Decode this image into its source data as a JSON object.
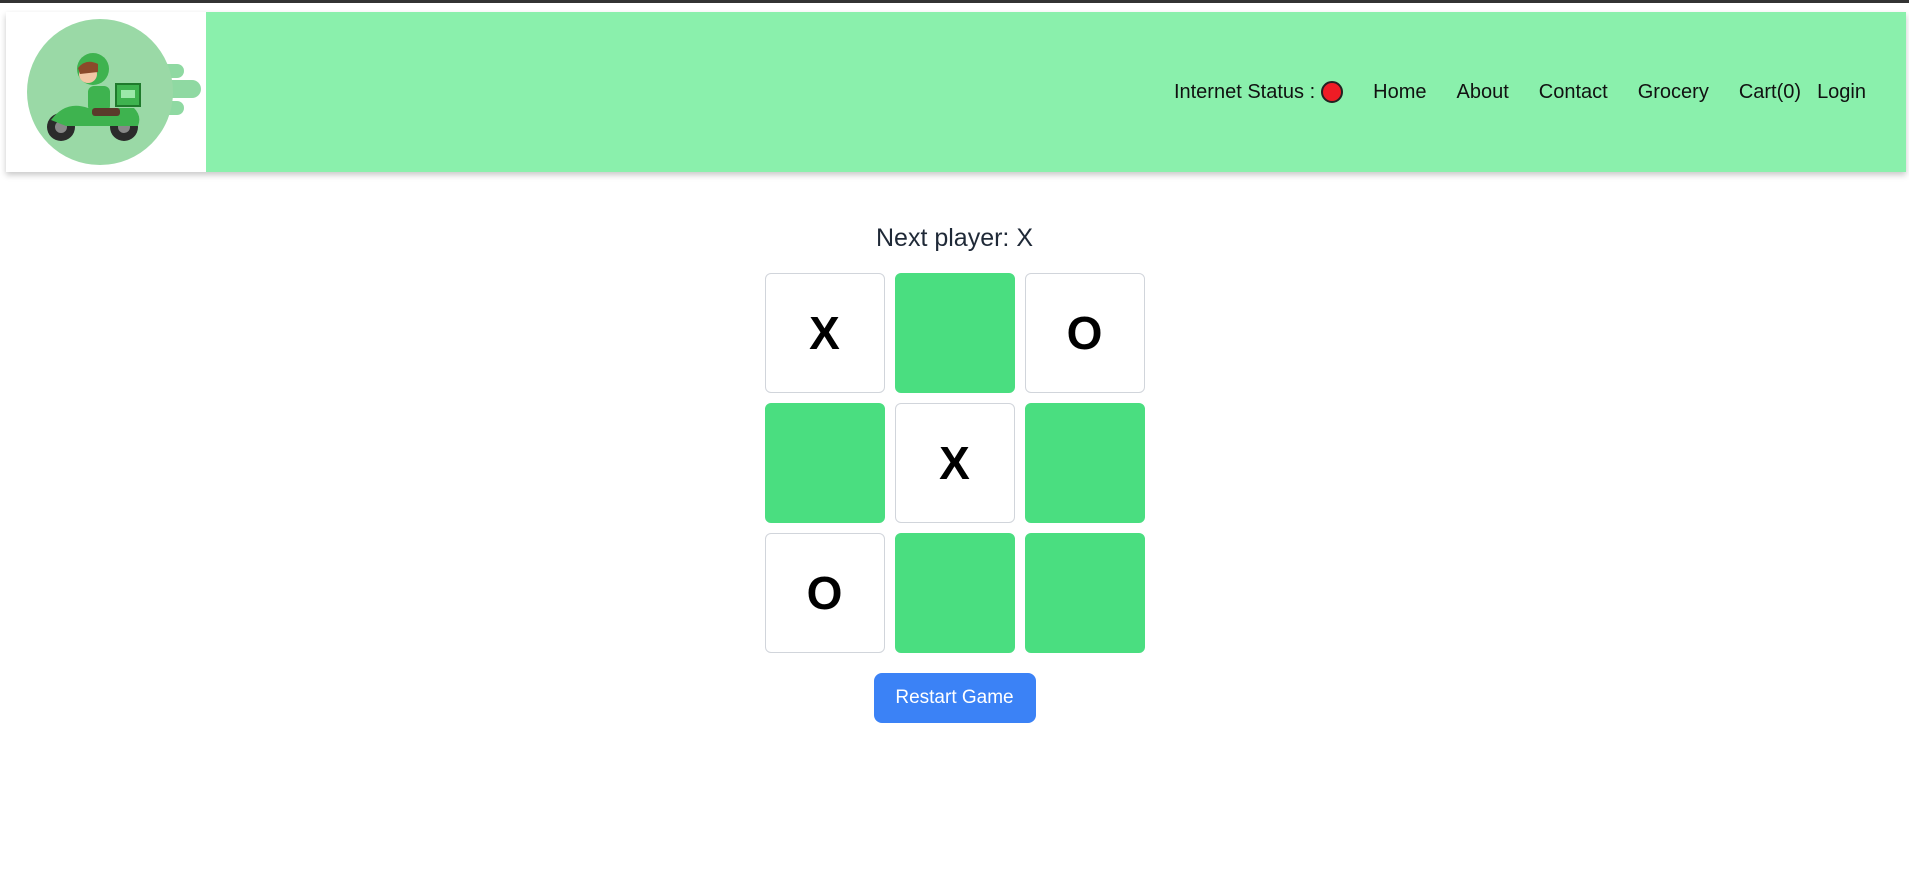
{
  "header": {
    "logo_icon": "delivery-scooter-logo",
    "nav": {
      "internet_status_label": "Internet Status :",
      "internet_status_color": "#ee1c25",
      "home": "Home",
      "about": "About",
      "contact": "Contact",
      "grocery": "Grocery",
      "cart": "Cart(0)",
      "login": "Login"
    }
  },
  "game": {
    "status": "Next player: X",
    "board": [
      "X",
      "",
      "O",
      "",
      "X",
      "",
      "O",
      "",
      ""
    ],
    "restart_label": "Restart Game"
  },
  "colors": {
    "header_bg": "#8af0ac",
    "empty_cell": "#4ade80",
    "button": "#3b82f6"
  }
}
